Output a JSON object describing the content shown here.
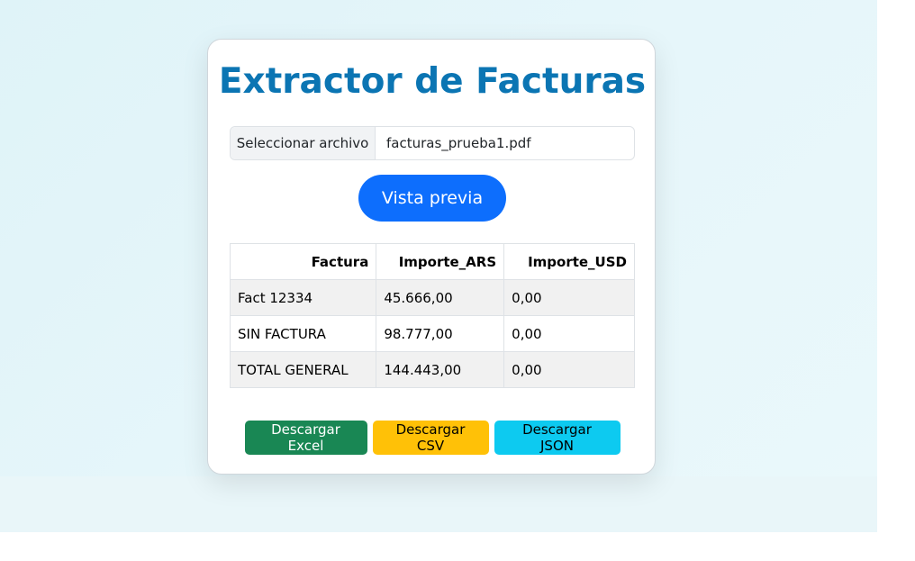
{
  "app": {
    "title": "Extractor de Facturas"
  },
  "file_input": {
    "button_label": "Seleccionar archivo",
    "file_name": "facturas_prueba1.pdf"
  },
  "preview_button": {
    "label": "Vista previa",
    "color": "#0d6efd"
  },
  "table": {
    "headers": [
      "Factura",
      "Importe_ARS",
      "Importe_USD"
    ],
    "rows": [
      [
        "Fact 12334",
        "45.666,00",
        "0,00"
      ],
      [
        "SIN FACTURA",
        "98.777,00",
        "0,00"
      ],
      [
        "TOTAL GENERAL",
        "144.443,00",
        "0,00"
      ]
    ]
  },
  "actions": {
    "excel": {
      "label": "Descargar Excel",
      "color": "#198754"
    },
    "csv": {
      "label": "Descargar CSV",
      "color": "#ffc107"
    },
    "json": {
      "label": "Descargar JSON",
      "color": "#0dcaf0"
    }
  },
  "colors": {
    "title": "#0b75b3"
  }
}
